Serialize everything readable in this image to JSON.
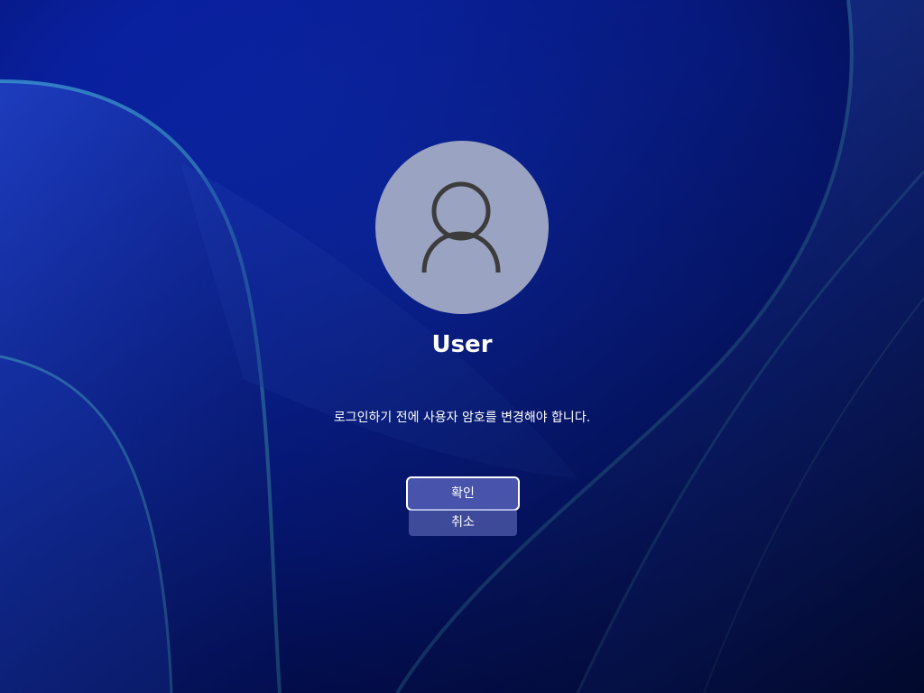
{
  "user": {
    "name": "User"
  },
  "message": "로그인하기 전에 사용자 암호를 변경해야 합니다.",
  "buttons": {
    "ok_label": "확인",
    "cancel_label": "취소"
  },
  "icons": {
    "avatar": "user-silhouette-icon"
  },
  "colors": {
    "background": "#0a1fa3",
    "avatar_bg": "#9aa3c2",
    "avatar_icon": "#3c3c3c",
    "text": "#ffffff"
  }
}
